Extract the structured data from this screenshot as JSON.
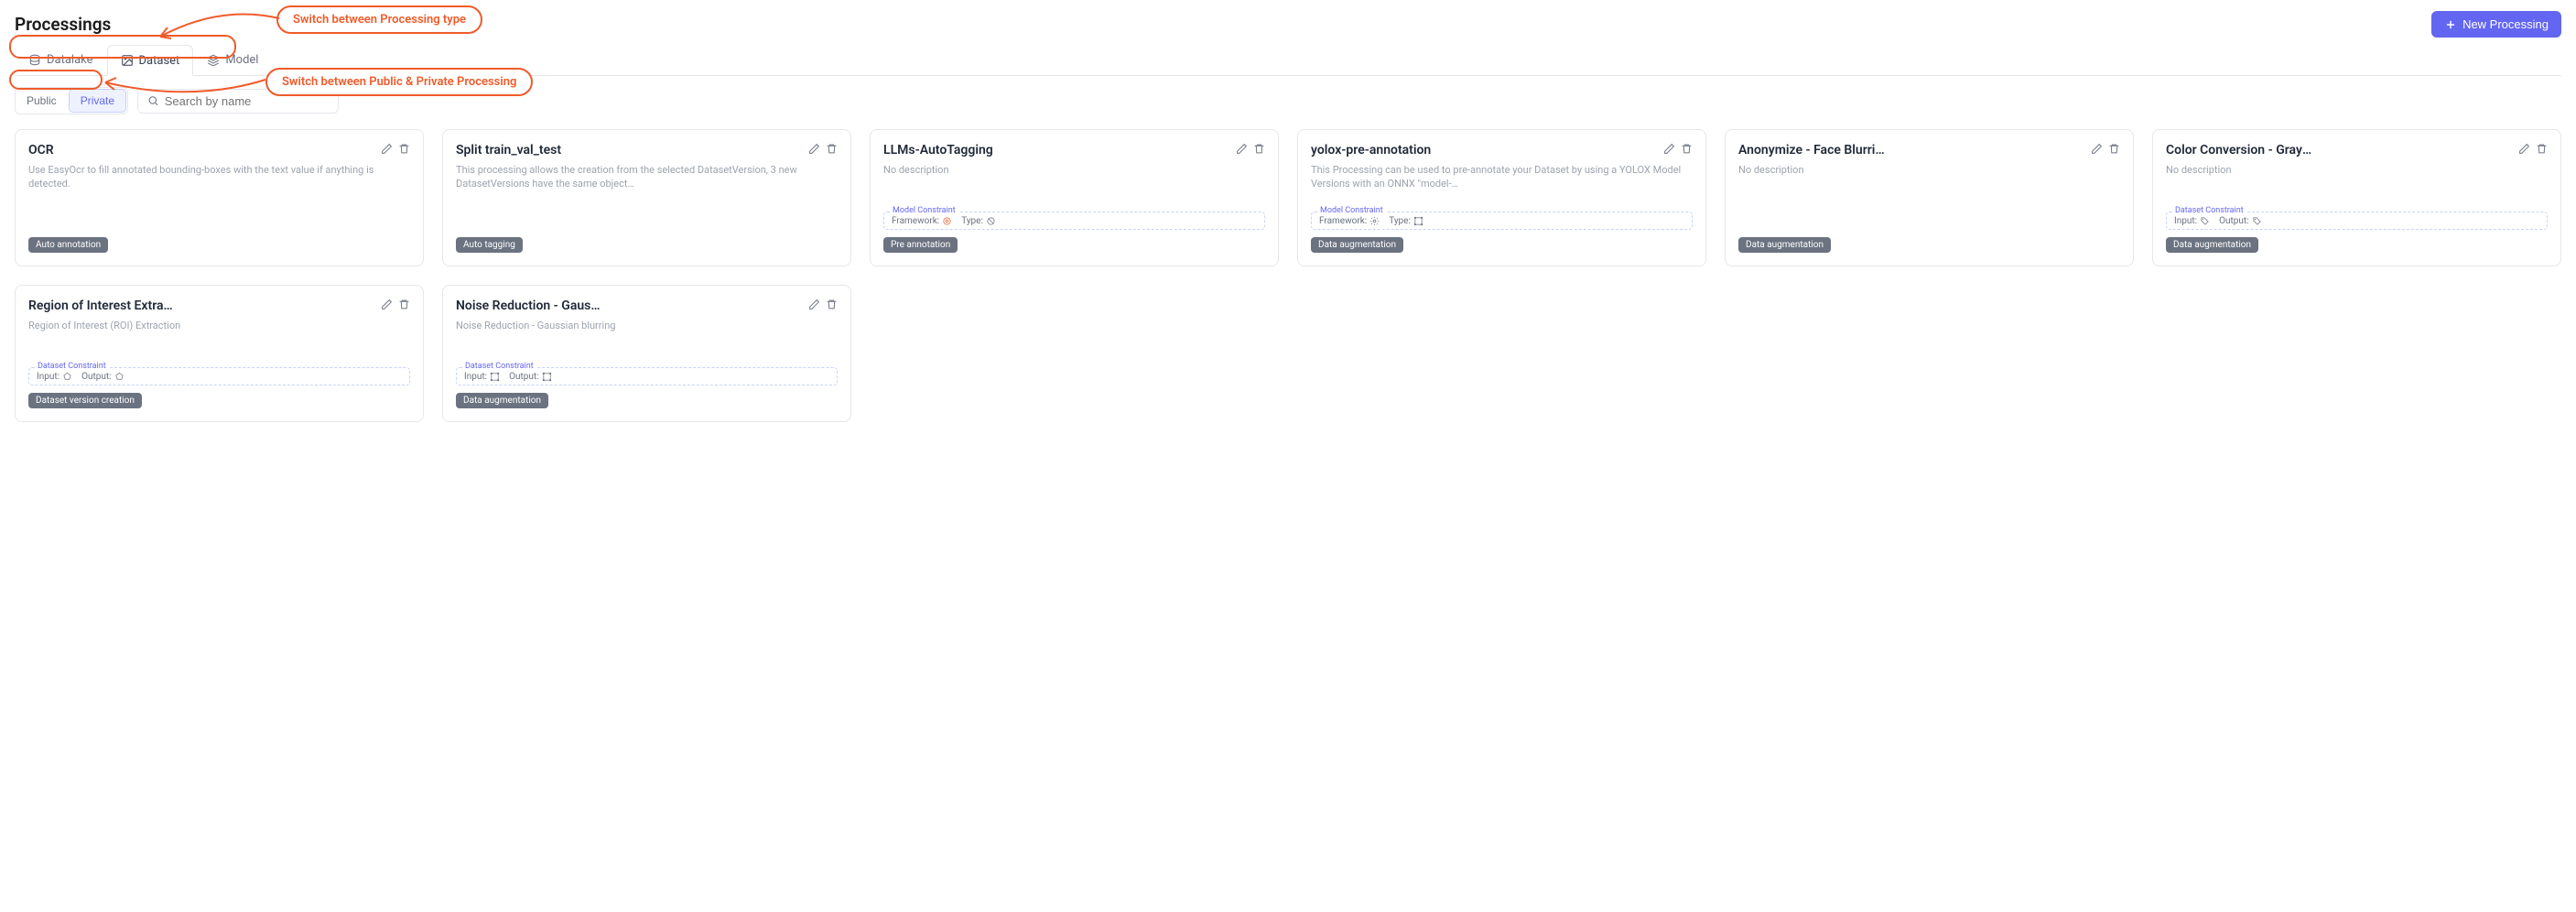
{
  "page_title": "Processings",
  "new_button": "New Processing",
  "tabs": {
    "datalake": "Datalake",
    "dataset": "Dataset",
    "model": "Model",
    "active": "dataset"
  },
  "filters": {
    "public": "Public",
    "private": "Private",
    "active": "private"
  },
  "search_placeholder": "Search by name",
  "callout_tabs": "Switch between Processing type",
  "callout_filters": "Switch between Public & Private Processing",
  "cards": [
    {
      "title": "OCR",
      "desc": "Use EasyOcr to fill annotated bounding-boxes with the text value if anything is detected.",
      "tag": "Auto annotation",
      "constraint": null
    },
    {
      "title": "Split train_val_test",
      "desc": "This processing allows the creation from the selected DatasetVersion, 3 new DatasetVersions have the same object…",
      "tag": "Auto tagging",
      "constraint": null
    },
    {
      "title": "LLMs-AutoTagging",
      "desc": "No description",
      "tag": "Pre annotation",
      "constraint": {
        "label": "Model Constraint",
        "k1": "Framework:",
        "i1": "onnx",
        "k2": "Type:",
        "i2": "block"
      }
    },
    {
      "title": "yolox-pre-annotation",
      "desc": "This Processing can be used to pre-annotate your Dataset by using a YOLOX Model Versions with an ONNX \"model-…",
      "tag": "Data augmentation",
      "constraint": {
        "label": "Model Constraint",
        "k1": "Framework:",
        "i1": "cog",
        "k2": "Type:",
        "i2": "bbox"
      }
    },
    {
      "title": "Anonymize - Face Blurring",
      "desc": "No description",
      "tag": "Data augmentation",
      "constraint": null
    },
    {
      "title": "Color Conversion - Graysc…",
      "desc": "No description",
      "tag": "Data augmentation",
      "constraint": {
        "label": "Dataset Constraint",
        "k1": "Input:",
        "i1": "tag",
        "k2": "Output:",
        "i2": "tag"
      }
    },
    {
      "title": "Region of Interest Extracti…",
      "desc": "Region of Interest (ROI) Extraction",
      "tag": "Dataset version creation",
      "constraint": {
        "label": "Dataset Constraint",
        "k1": "Input:",
        "i1": "poly",
        "k2": "Output:",
        "i2": "poly"
      }
    },
    {
      "title": "Noise Reduction - Gaussi…",
      "desc": "Noise Reduction - Gaussian blurring",
      "tag": "Data augmentation",
      "constraint": {
        "label": "Dataset Constraint",
        "k1": "Input:",
        "i1": "bbox",
        "k2": "Output:",
        "i2": "bbox"
      }
    }
  ]
}
